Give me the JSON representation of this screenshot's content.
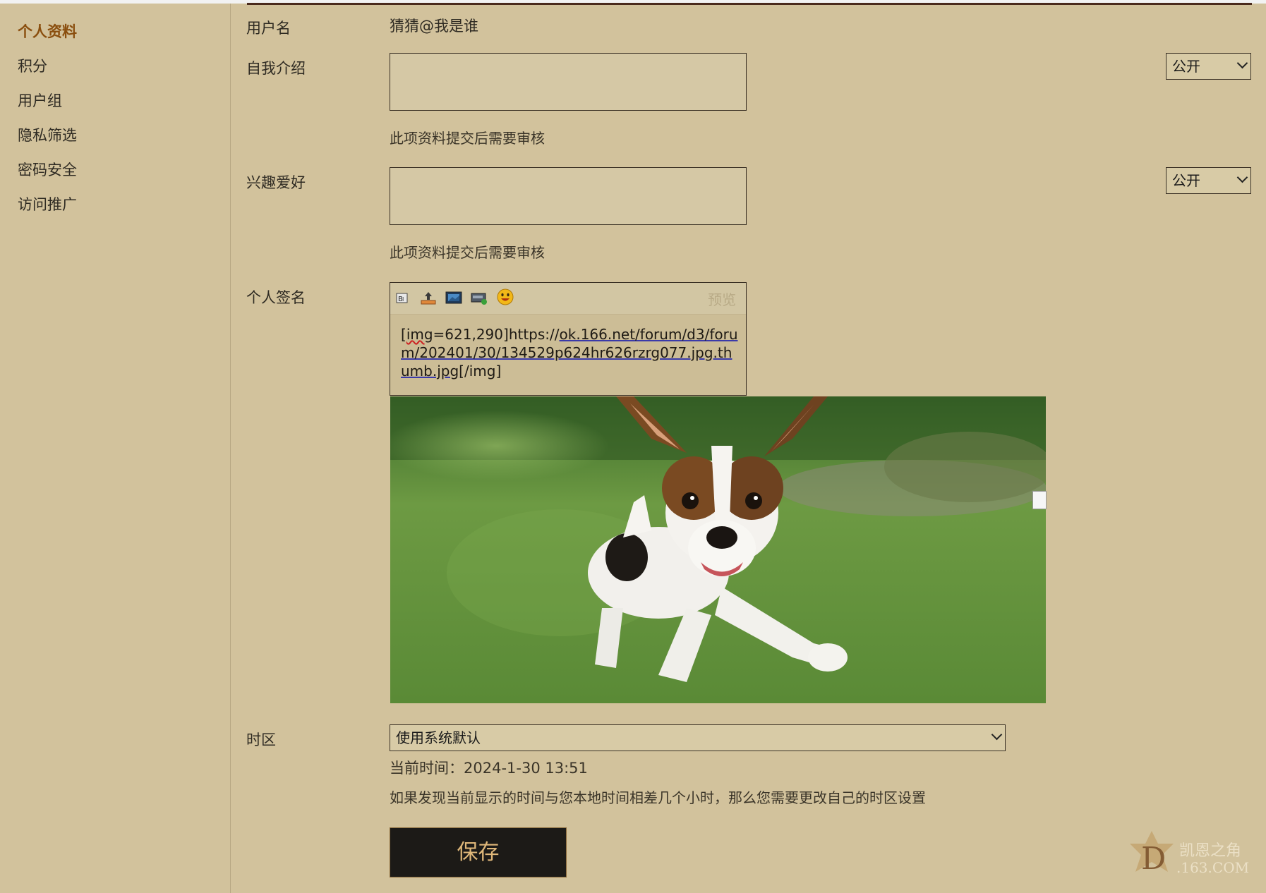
{
  "sidebar": {
    "items": [
      {
        "label": "个人资料",
        "active": true
      },
      {
        "label": "积分"
      },
      {
        "label": "用户组"
      },
      {
        "label": "隐私筛选"
      },
      {
        "label": "密码安全"
      },
      {
        "label": "访问推广"
      }
    ]
  },
  "form": {
    "username_label": "用户名",
    "username_value": "猜猜@我是谁",
    "intro_label": "自我介绍",
    "intro_privacy": "公开",
    "intro_note": "此项资料提交后需要审核",
    "hobby_label": "兴趣爱好",
    "hobby_privacy": "公开",
    "hobby_note": "此项资料提交后需要审核",
    "signature_label": "个人签名",
    "signature_preview_link": "预览",
    "signature_text_prefix": "[",
    "signature_text_img": "img",
    "signature_text_mid": "=621,290]https://",
    "signature_text_url": "ok.166.net/forum/d3/forum/202401/30/134529p624hr626rzrg077.jpg.thumb.jpg",
    "signature_text_suffix": "[/img]",
    "signature_toolbar_icons": [
      "font-icon",
      "image-upload-icon",
      "image-icon",
      "media-icon",
      "emoji-icon"
    ],
    "timezone_label": "时区",
    "timezone_value": "使用系统默认",
    "current_time": "当前时间：2024-1-30 13:51",
    "timezone_hint": "如果发现当前显示的时间与您本地时间相差几个小时，那么您需要更改自己的时区设置",
    "save_label": "保存"
  },
  "watermark": {
    "line1": "凯恩之角",
    "line2": ".163.COM",
    "logo_letter": "D"
  },
  "colors": {
    "background": "#d2c29c",
    "active_nav": "#8a4e0e",
    "button_bg": "#1c1a17",
    "button_text": "#e0b87a"
  }
}
